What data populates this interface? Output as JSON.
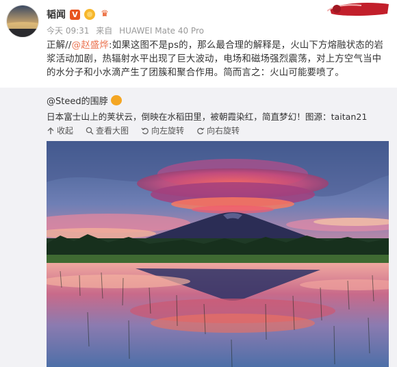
{
  "post": {
    "author": "韬闻",
    "verified_badge": "V",
    "time": "今天 09:31",
    "source_prefix": "来自",
    "device": "HUAWEI Mate 40 Pro",
    "text_prefix": "正解//",
    "mention": "@赵盛烨",
    "text_body": ":如果这图不是ps的，那么最合理的解释是，火山下方熔融状态的岩浆活动加剧，热辐射水平出现了巨大波动，电场和磁场强烈震荡，对上方空气当中的水分子和小水滴产生了团簇和聚合作用。简而言之：火山可能要喷了。"
  },
  "repost": {
    "author": "@Steed的围脖",
    "text": "日本富士山上的荚状云，倒映在水稻田里，被朝霞染红，简直梦幻！图源：taitan21",
    "actions": [
      {
        "label": "收起",
        "icon": "collapse-icon"
      },
      {
        "label": "查看大图",
        "icon": "zoom-icon"
      },
      {
        "label": "向左旋转",
        "icon": "rotate-left-icon"
      },
      {
        "label": "向右旋转",
        "icon": "rotate-right-icon"
      }
    ]
  },
  "colors": {
    "mention": "#eb7350",
    "repost_bg": "#f2f2f5",
    "meta": "#999999"
  }
}
